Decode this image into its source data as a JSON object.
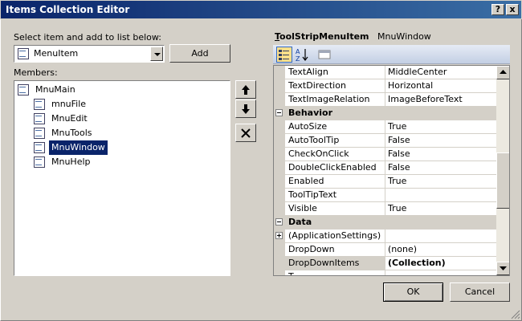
{
  "window": {
    "title": "Items Collection Editor",
    "help_label": "?",
    "close_label": "x"
  },
  "select_label": "Select item and add to list below:",
  "item_type_combo": {
    "value": "MenuItem"
  },
  "add_button": "Add",
  "members_label": "Members:",
  "members": [
    {
      "label": "MnuMain",
      "level": 0,
      "selected": false
    },
    {
      "label": "mnuFile",
      "level": 1,
      "selected": false
    },
    {
      "label": "MnuEdit",
      "level": 1,
      "selected": false
    },
    {
      "label": "MnuTools",
      "level": 1,
      "selected": false
    },
    {
      "label": "MnuWindow",
      "level": 1,
      "selected": true
    },
    {
      "label": "MnuHelp",
      "level": 1,
      "selected": false
    }
  ],
  "property_grid": {
    "type_name": "ToolStripMenuItem",
    "type_name_rest": "oolStripMenuItem",
    "type_name_first": "T",
    "object_name": "MnuWindow",
    "rows": [
      {
        "kind": "prop",
        "name": "TextAlign",
        "value": "MiddleCenter"
      },
      {
        "kind": "prop",
        "name": "TextDirection",
        "value": "Horizontal"
      },
      {
        "kind": "prop",
        "name": "TextImageRelation",
        "value": "ImageBeforeText"
      },
      {
        "kind": "cat",
        "name": "Behavior"
      },
      {
        "kind": "prop",
        "name": "AutoSize",
        "value": "True"
      },
      {
        "kind": "prop",
        "name": "AutoToolTip",
        "value": "False"
      },
      {
        "kind": "prop",
        "name": "CheckOnClick",
        "value": "False"
      },
      {
        "kind": "prop",
        "name": "DoubleClickEnabled",
        "value": "False"
      },
      {
        "kind": "prop",
        "name": "Enabled",
        "value": "True"
      },
      {
        "kind": "prop",
        "name": "ToolTipText",
        "value": ""
      },
      {
        "kind": "prop",
        "name": "Visible",
        "value": "True"
      },
      {
        "kind": "cat",
        "name": "Data"
      },
      {
        "kind": "expandable",
        "name": "(ApplicationSettings)",
        "value": ""
      },
      {
        "kind": "prop",
        "name": "DropDown",
        "value": "(none)"
      },
      {
        "kind": "selected",
        "name": "DropDownItems",
        "value": "(Collection)"
      },
      {
        "kind": "prop",
        "name": "T",
        "value": ""
      }
    ]
  },
  "ok_button": "OK",
  "cancel_button": "Cancel"
}
